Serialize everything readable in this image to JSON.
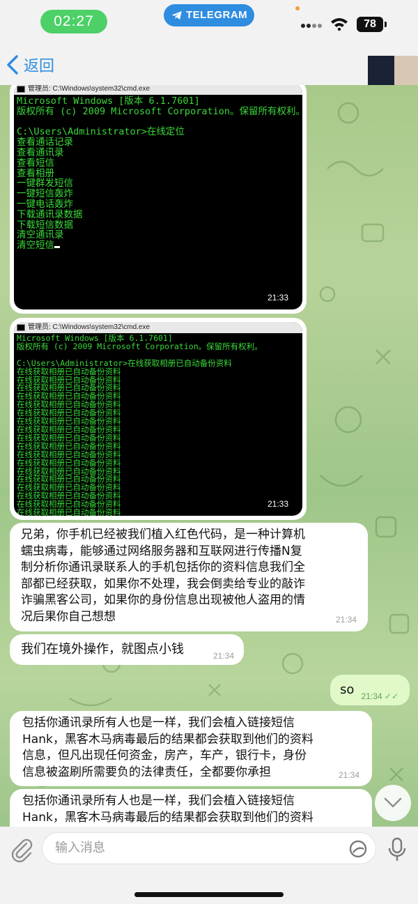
{
  "status_bar": {
    "time": "02:27",
    "app_pill": "TELEGRAM",
    "battery": "78"
  },
  "nav": {
    "back_label": "返回"
  },
  "messages": {
    "cmd1": {
      "title": "管理员: C:\\Windows\\system32\\cmd.exe",
      "lines": "Microsoft Windows [版本 6.1.7601]\n版权所有 (c) 2009 Microsoft Corporation。保留所有权利。\n\nC:\\Users\\Administrator>在线定位\n查看通话记录\n查看通讯录\n查看短信\n查看相册\n一键群发短信\n一键短信轰炸\n一键电话轰炸\n下载通讯录数据\n下载短信数据\n清空通讯录\n清空短信",
      "time": "21:33"
    },
    "cmd2": {
      "title": "管理员: C:\\Windows\\system32\\cmd.exe",
      "lines": "Microsoft Windows [版本 6.1.7601]\n版权所有 (c) 2009 Microsoft Corporation。保留所有权利。\n\nC:\\Users\\Administrator>在线获取相册已自动备份资料\n在线获取相册已自动备份资料\n在线获取相册已自动备份资料\n在线获取相册已自动备份资料\n在线获取相册已自动备份资料\n在线获取相册已自动备份资料\n在线获取相册已自动备份资料\n在线获取相册已自动备份资料\n在线获取相册已自动备份资料\n在线获取相册已自动备份资料\n在线获取相册已自动备份资料\n在线获取相册已自动备份资料\n在线获取相册已自动备份资料\n在线获取相册已自动备份资料\n在线获取相册已自动备份资料\n在线获取相册已自动备份资料\n在线获取相册已自动备份资料\n在线获取相册已自动备份资料\n在线获取相册已自动备份资料",
      "time": "21:33"
    },
    "text1": {
      "lines": [
        "兄弟，你手机已经被我们植入红色代码，是一种计算机",
        "蠕虫病毒，能够通过网络服务器和互联网进行传播N复",
        "制分析你通讯录联系人的手机包括你的资料信息我们全",
        "部都已经获取，如果你不处理，我会倒卖给专业的敲诈",
        "诈骗黑客公司，如果你的身份信息出现被他人盗用的情",
        "况后果你自己想想"
      ],
      "time": "21:34"
    },
    "text2": {
      "text": "我们在境外操作，就图点小钱",
      "time": "21:34"
    },
    "out1": {
      "text": "so",
      "time": "21:34"
    },
    "text3": {
      "lines": [
        "包括你通讯录所有人也是一样，我们会植入链接短信",
        "Hank，黑客木马病毒最后的结果都会获取到他们的资料",
        "信息，但凡出现任何资金，房产，车产，银行卡，身份",
        "信息被盗刷所需要负的法律责任，全都要你承担"
      ],
      "time": "21:34"
    },
    "text4": {
      "lines": [
        "包括你通讯录所有人也是一样，我们会植入链接短信",
        "Hank，黑客木马病毒最后的结果都会获取到他们的资料"
      ]
    }
  },
  "input": {
    "placeholder": "输入消息"
  },
  "colors": {
    "telegram_blue": "#2f8de0",
    "status_green": "#4cd067",
    "outgoing_bubble": "#e1f8c9",
    "terminal_green": "#3ad93a"
  }
}
